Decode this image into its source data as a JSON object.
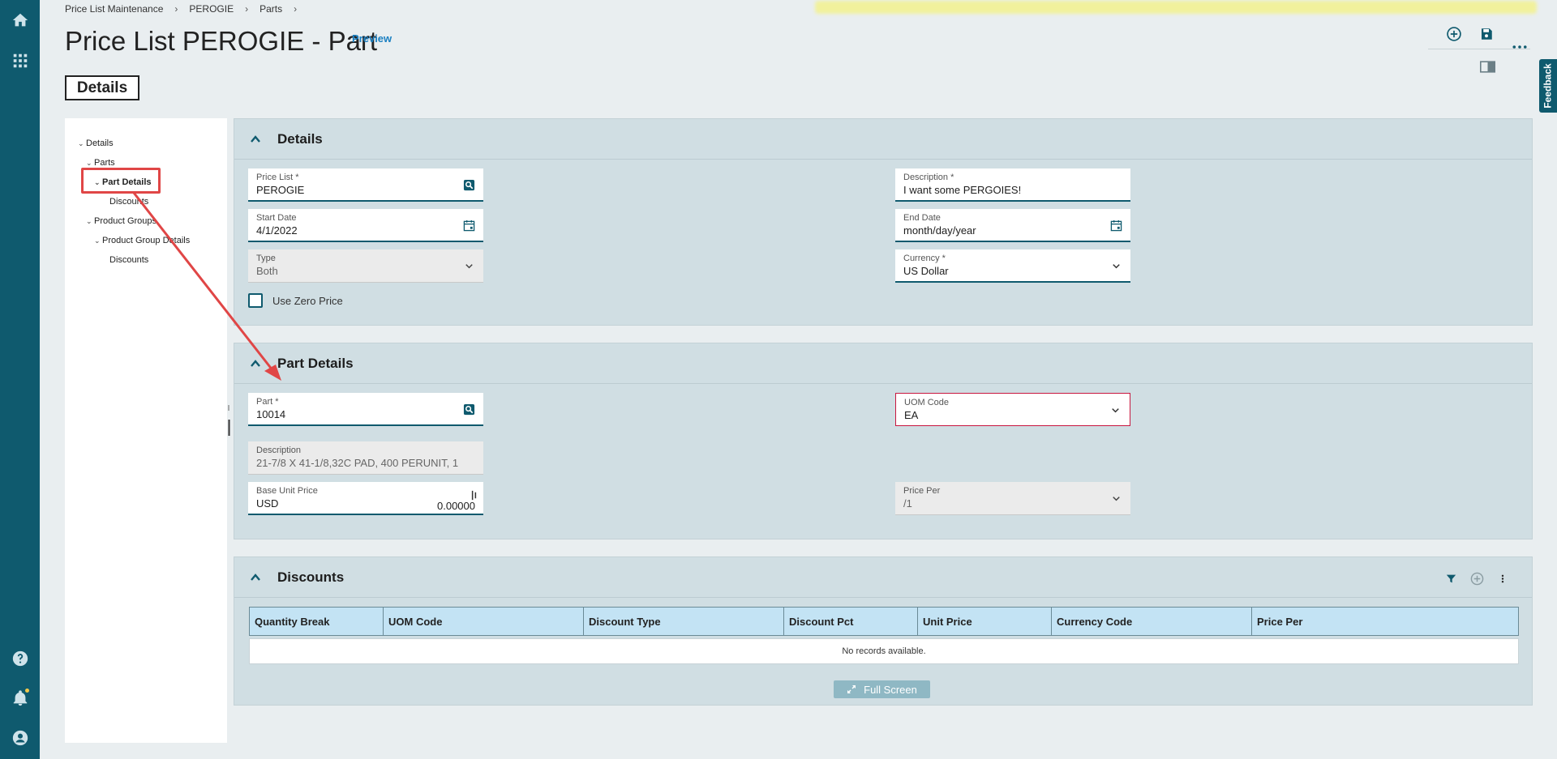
{
  "breadcrumb": [
    "Price List Maintenance",
    "PEROGIE",
    "Parts"
  ],
  "breadcrumb_sep": "›",
  "page": {
    "title": "Price List PEROGIE - Part",
    "preview": "Preview",
    "tab": "Details"
  },
  "feedback": "Feedback",
  "icons": {
    "home": "home-icon",
    "apps": "apps-grid-icon",
    "help": "help-icon",
    "notifications": "bell-icon",
    "user": "user-icon",
    "add": "add-circle-icon",
    "save": "save-icon",
    "more": "more-horizontal-icon",
    "panel": "panel-toggle-icon"
  },
  "colors": {
    "rail": "#0f5a6e",
    "accent": "#1a7fc1",
    "highlight": "#e04646",
    "grid_header": "#c3e3f4"
  },
  "tree": {
    "details": "Details",
    "parts": "Parts",
    "part_details": "Part Details",
    "part_discounts": "Discounts",
    "product_groups": "Product Groups",
    "product_group_details": "Product Group Details",
    "group_discounts": "Discounts"
  },
  "details_section": {
    "title": "Details",
    "price_list": {
      "label": "Price List *",
      "value": "PEROGIE"
    },
    "description": {
      "label": "Description *",
      "value": "I want some PERGOIES!"
    },
    "start_date": {
      "label": "Start Date",
      "value": "4/1/2022"
    },
    "end_date": {
      "label": "End Date",
      "value": "month/day/year"
    },
    "type": {
      "label": "Type",
      "value": "Both"
    },
    "currency": {
      "label": "Currency *",
      "value": "US Dollar"
    },
    "use_zero_price": {
      "label": "Use Zero Price",
      "checked": false
    }
  },
  "part_section": {
    "title": "Part Details",
    "part": {
      "label": "Part *",
      "value": "10014"
    },
    "uom_code": {
      "label": "UOM Code",
      "value": "EA"
    },
    "description": {
      "label": "Description",
      "value": "21-7/8 X 41-1/8,32C PAD, 400 PERUNIT, 1"
    },
    "base_unit_price": {
      "label": "Base Unit Price",
      "currency": "USD",
      "value": "0.00000"
    },
    "price_per": {
      "label": "Price Per",
      "value": "/1"
    }
  },
  "discounts_section": {
    "title": "Discounts",
    "columns": [
      "Quantity Break",
      "UOM Code",
      "Discount Type",
      "Discount Pct",
      "Unit Price",
      "Currency Code",
      "Price Per"
    ],
    "empty": "No records available.",
    "fullscreen": "Full Screen"
  }
}
